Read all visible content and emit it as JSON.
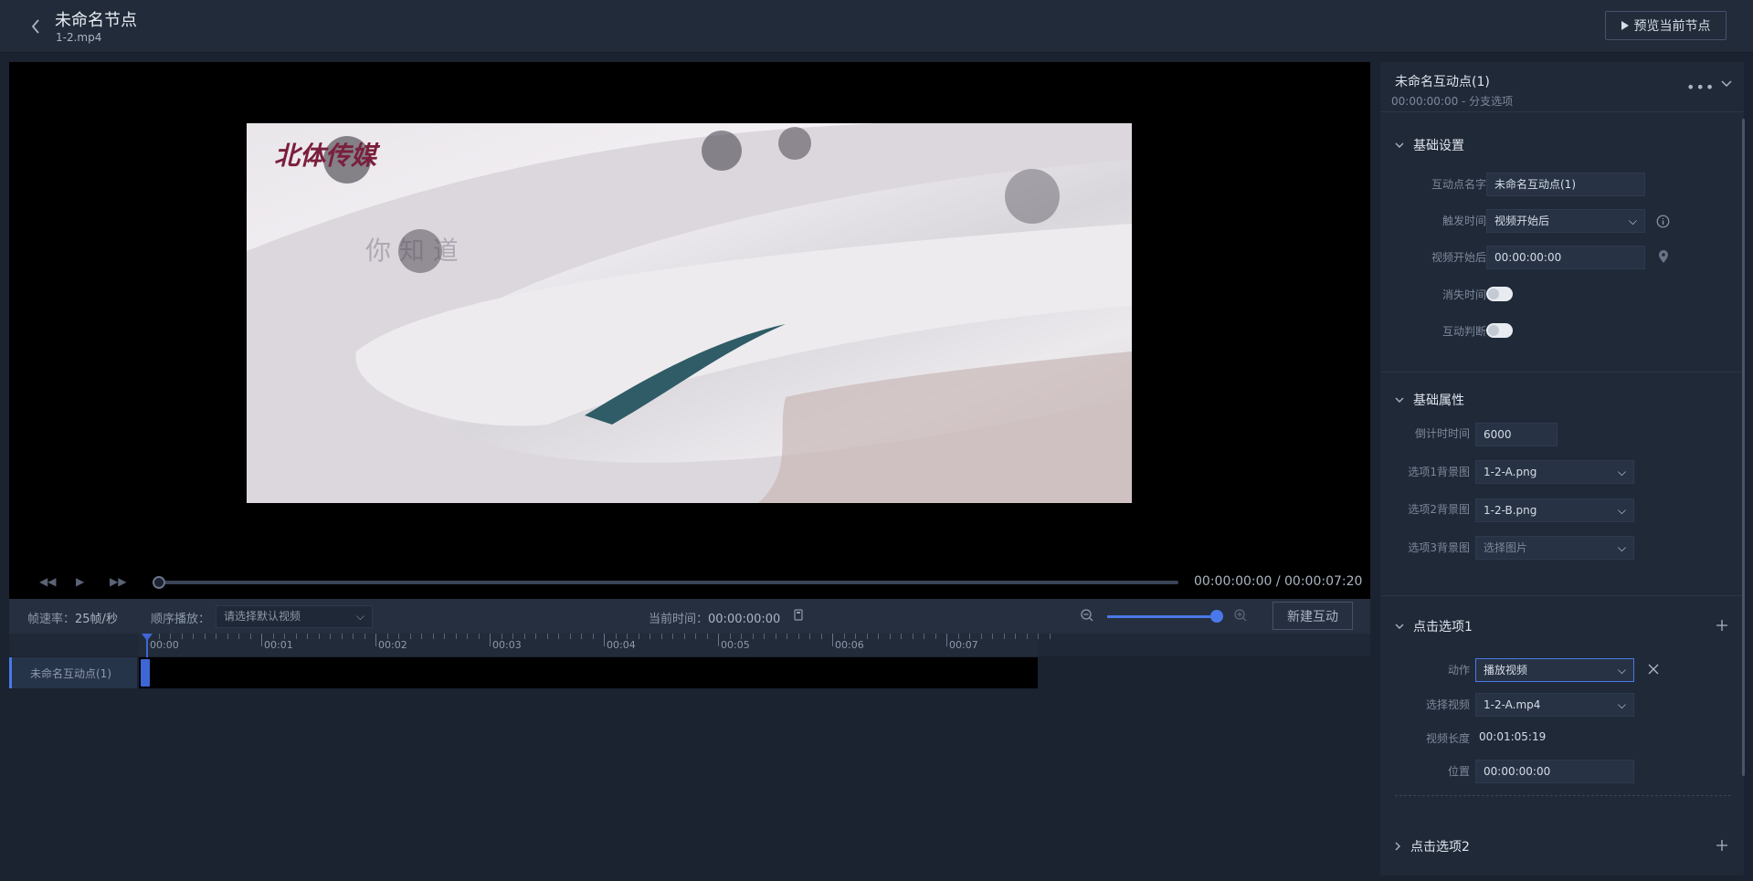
{
  "header": {
    "title": "未命名节点",
    "file": "1-2.mp4",
    "preview_label": "预览当前节点"
  },
  "player": {
    "time": "00:00:00:00 / 00:00:07:20",
    "watermark": "北体传媒",
    "overlay_text": "你 知 道"
  },
  "toolbar": {
    "fps_label": "帧速率：",
    "fps_value": "25帧/秒",
    "order_label": "顺序播放：",
    "order_placeholder": "请选择默认视频",
    "current_time_label": "当前时间：",
    "current_time_value": "00:00:00:00",
    "new_label": "新建互动",
    "zoom_level": 1.0
  },
  "timeline": {
    "ruler": [
      "00:00",
      "00:01",
      "00:02",
      "00:03",
      "00:04",
      "00:05",
      "00:06",
      "00:07"
    ],
    "track_label": "未命名互动点(1)"
  },
  "panel": {
    "title": "未命名互动点(1)",
    "subtitle": "00:00:00:00 - 分支选项",
    "sections": {
      "basic_settings": "基础设置",
      "basic_props": "基础属性",
      "option1": "点击选项1",
      "option2": "点击选项2"
    },
    "basic_settings": {
      "name_label": "互动点名字",
      "name_value": "未命名互动点(1)",
      "trigger_label": "触发时间",
      "trigger_value": "视频开始后",
      "after_label": "视频开始后",
      "after_value": "00:00:00:00",
      "disappear_label": "消失时间",
      "judge_label": "互动判断"
    },
    "basic_props": {
      "countdown_label": "倒计时时间",
      "countdown_value": "6000",
      "bg1_label": "选项1背景图",
      "bg1_value": "1-2-A.png",
      "bg2_label": "选项2背景图",
      "bg2_value": "1-2-B.png",
      "bg3_label": "选项3背景图",
      "bg3_placeholder": "选择图片"
    },
    "option1": {
      "action_label": "动作",
      "action_value": "播放视频",
      "video_label": "选择视频",
      "video_value": "1-2-A.mp4",
      "length_label": "视频长度",
      "length_value": "00:01:05:19",
      "position_label": "位置",
      "position_value": "00:00:00:00"
    }
  }
}
